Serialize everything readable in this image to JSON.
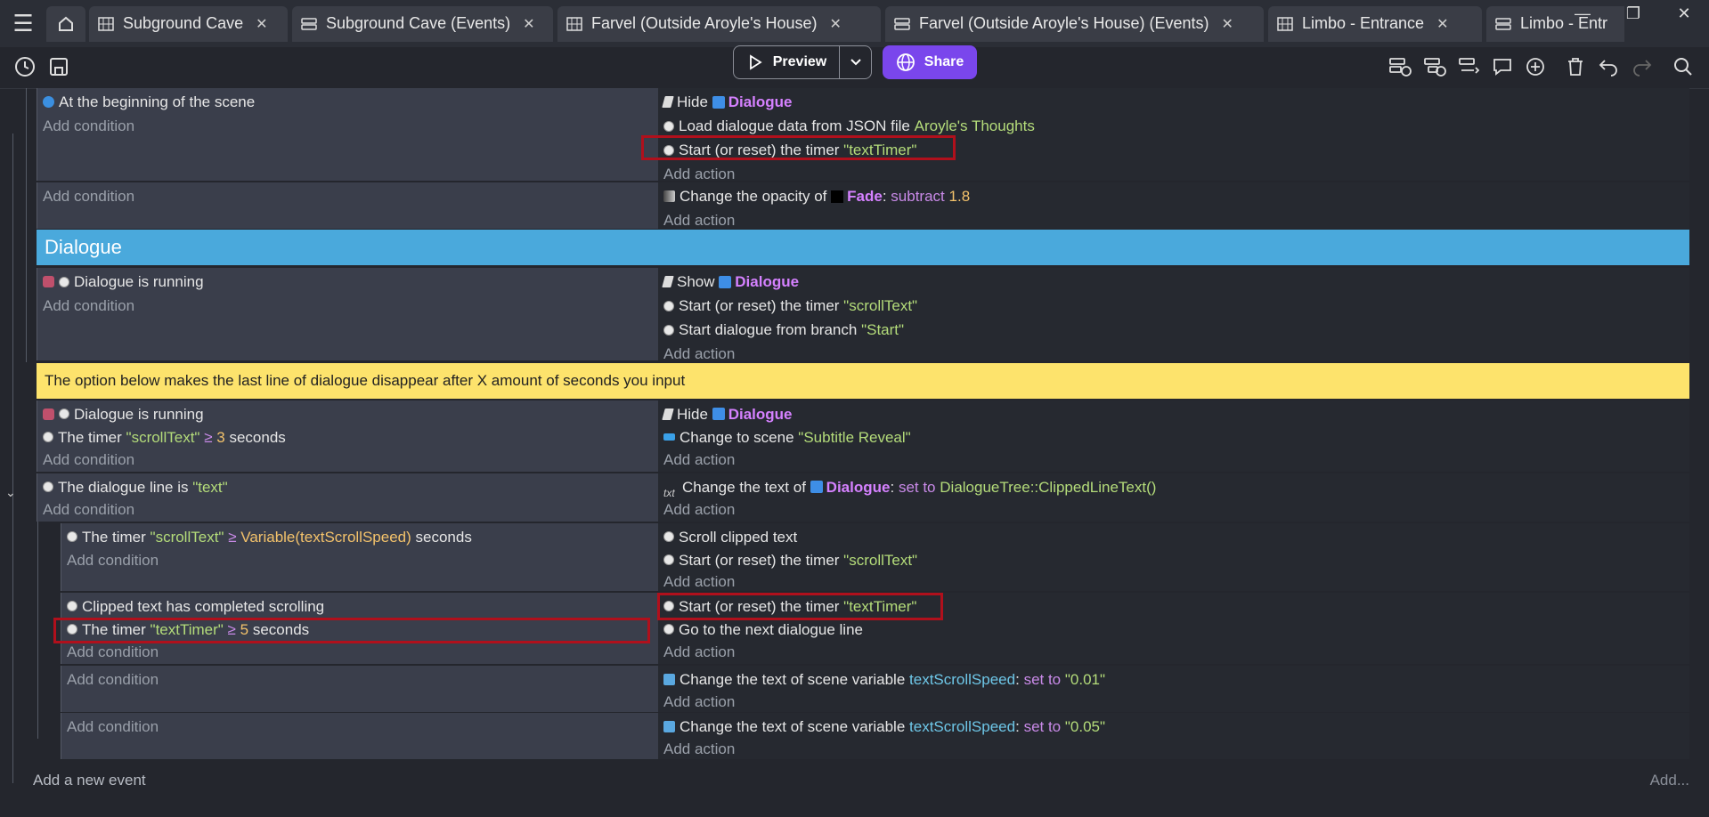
{
  "tabs": [
    {
      "label": "Subground Cave",
      "kind": "scene"
    },
    {
      "label": "Subground Cave (Events)",
      "kind": "events"
    },
    {
      "label": "Farvel (Outside Aroyle's House)",
      "kind": "scene"
    },
    {
      "label": "Farvel (Outside Aroyle's House) (Events)",
      "kind": "events"
    },
    {
      "label": "Limbo - Entrance",
      "kind": "scene"
    },
    {
      "label": "Limbo - Entr",
      "kind": "events"
    }
  ],
  "toolbar": {
    "preview_label": "Preview",
    "share_label": "Share"
  },
  "placeholders": {
    "add_condition": "Add condition",
    "add_action": "Add action",
    "add_event": "Add a new event",
    "add_more": "Add..."
  },
  "ev1": {
    "cond1": "At the beginning of the scene",
    "act1_pre": "Hide",
    "act1_obj": "Dialogue",
    "act2_pre": "Load dialogue data from JSON file",
    "act2_str": "Aroyle's Thoughts",
    "act3_pre": "Start (or reset) the timer",
    "act3_str": "\"textTimer\""
  },
  "ev2": {
    "act1_pre": "Change the opacity of",
    "act1_obj": "Fade",
    "act1_sep": ":",
    "act1_op": "subtract",
    "act1_num": "1.8"
  },
  "group_title": "Dialogue",
  "ev3": {
    "cond1": "Dialogue is running",
    "act1_pre": "Show",
    "act1_obj": "Dialogue",
    "act2_pre": "Start (or reset) the timer",
    "act2_str": "\"scrollText\"",
    "act3_pre": "Start dialogue from branch",
    "act3_str": "\"Start\""
  },
  "comment": "The option below makes the last line of dialogue disappear after X amount of seconds you input",
  "ev4": {
    "cond1": "Dialogue is running",
    "cond2_pre": "The timer",
    "cond2_str": "\"scrollText\"",
    "cond2_op": "≥",
    "cond2_num": "3",
    "cond2_post": "seconds",
    "act1_pre": "Hide",
    "act1_obj": "Dialogue",
    "act2_pre": "Change to scene",
    "act2_str": "\"Subtitle Reveal\""
  },
  "ev5": {
    "cond1_pre": "The dialogue line is",
    "cond1_str": "\"text\"",
    "act1_pre": "Change the text of",
    "act1_obj": "Dialogue",
    "act1_sep": ":",
    "act1_op": "set to",
    "act1_val": "DialogueTree::ClippedLineText()"
  },
  "ev6": {
    "cond1_pre": "The timer",
    "cond1_str": "\"scrollText\"",
    "cond1_op": "≥",
    "cond1_num": "Variable(textScrollSpeed)",
    "cond1_post": "seconds",
    "act1": "Scroll clipped text",
    "act2_pre": "Start (or reset) the timer",
    "act2_str": "\"scrollText\""
  },
  "ev7": {
    "cond1": "Clipped text has completed scrolling",
    "cond2_pre": "The timer",
    "cond2_str": "\"textTimer\"",
    "cond2_op": "≥",
    "cond2_num": "5",
    "cond2_post": "seconds",
    "act1_pre": "Start (or reset) the timer",
    "act1_str": "\"textTimer\"",
    "act2": "Go to the next dialogue line"
  },
  "ev8": {
    "act1_pre": "Change the text of scene variable",
    "act1_var": "textScrollSpeed",
    "act1_sep": ":",
    "act1_op": "set to",
    "act1_str": "\"0.01\""
  },
  "ev9": {
    "act1_pre": "Change the text of scene variable",
    "act1_var": "textScrollSpeed",
    "act1_sep": ":",
    "act1_op": "set to",
    "act1_str": "\"0.05\""
  }
}
